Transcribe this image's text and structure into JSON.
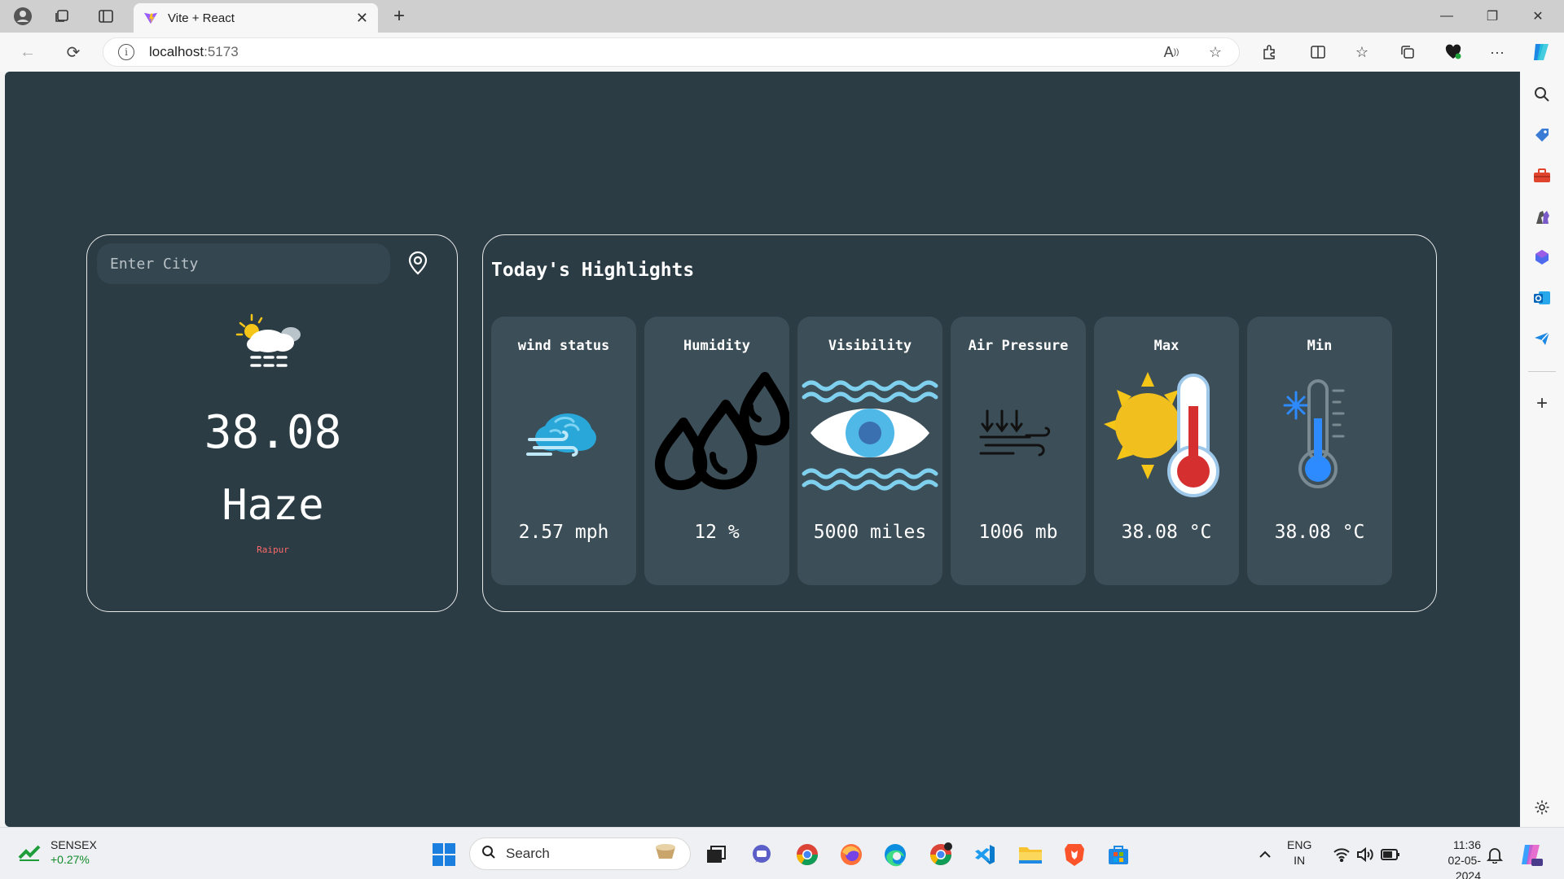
{
  "browser": {
    "tab_title": "Vite + React",
    "url_host": "localhost",
    "url_port": ":5173"
  },
  "app": {
    "search": {
      "placeholder": "Enter City"
    },
    "current": {
      "temperature": "38.08",
      "condition": "Haze",
      "city": "Raipur"
    },
    "highlights_title": "Today's Highlights",
    "highlights": [
      {
        "label": "wind status",
        "value": "2.57 mph",
        "icon": "wind-cloud-icon"
      },
      {
        "label": "Humidity",
        "value": "12 %",
        "icon": "water-drops-icon"
      },
      {
        "label": "Visibility",
        "value": "5000 miles",
        "icon": "eye-waves-icon"
      },
      {
        "label": "Air Pressure",
        "value": "1006 mb",
        "icon": "pressure-icon"
      },
      {
        "label": "Max",
        "value": "38.08 °C",
        "icon": "hot-thermometer-icon"
      },
      {
        "label": "Min",
        "value": "38.08 °C",
        "icon": "cold-thermometer-icon"
      }
    ]
  },
  "taskbar": {
    "ticker_name": "SENSEX",
    "ticker_change": "+0.27%",
    "search_label": "Search",
    "lang_line1": "ENG",
    "lang_line2": "IN",
    "time": "11:36",
    "date": "02-05-2024"
  }
}
